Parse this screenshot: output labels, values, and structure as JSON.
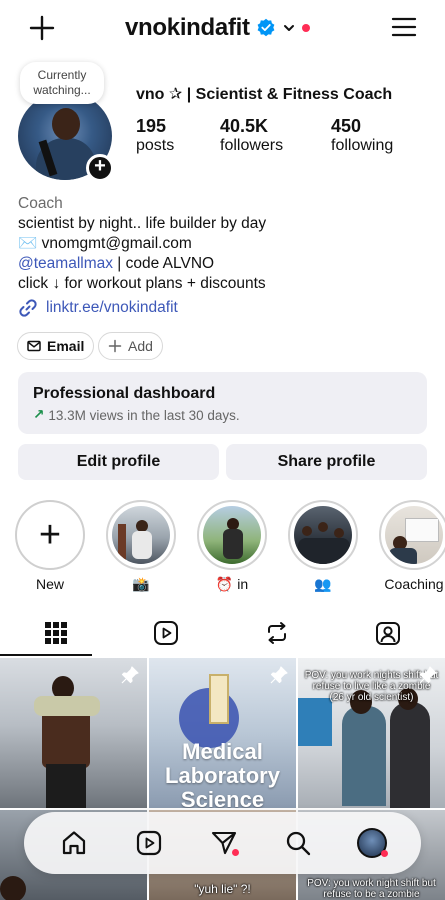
{
  "header": {
    "username": "vnokindafit",
    "icons": [
      "plus-icon",
      "verified-badge-icon",
      "chevron-down-icon",
      "notification-dot",
      "hamburger-menu-icon"
    ]
  },
  "note": {
    "text": "Currently watching..."
  },
  "profile": {
    "full_name": "vno ✰ | Scientist & Fitness Coach",
    "stats": [
      {
        "value": "195",
        "label": "posts"
      },
      {
        "value": "40.5K",
        "label": "followers"
      },
      {
        "value": "450",
        "label": "following"
      }
    ],
    "category": "Coach",
    "bio_line1": "scientist by night.. life builder by day",
    "bio_email_icon": "✉️",
    "bio_email": "vnomgmt@gmail.com",
    "bio_mention": "@teamallmax",
    "bio_code": " | code ALVNO",
    "bio_line4": "click ↓ for workout plans + discounts",
    "link": "linktr.ee/vnokindafit"
  },
  "chips": {
    "email": "Email",
    "add": "Add"
  },
  "dashboard": {
    "title": "Professional dashboard",
    "subtitle": "13.3M views in the last 30 days.",
    "arrow": "↗"
  },
  "buttons": {
    "edit": "Edit profile",
    "share": "Share profile"
  },
  "highlights": [
    {
      "label": "New"
    },
    {
      "label": "📸"
    },
    {
      "label": "⏰ in"
    },
    {
      "label": "👥"
    },
    {
      "label": "Coaching"
    }
  ],
  "tabs": [
    "grid-icon",
    "reels-icon",
    "reposts-icon",
    "tagged-icon"
  ],
  "grid": {
    "tile2_text": "Medical Laboratory Science",
    "tile3_caption": "POV: you work nights shift but refuse to live like a zombie (26 yr old scientist)",
    "tile5_caption": "\"yuh lie\" ?!",
    "tile6_caption": "POV: you work night shift but refuse to be a zombie"
  },
  "colors": {
    "link": "#3d58b8",
    "verified": "#0095f6",
    "notification": "#ff2d55",
    "panel": "#efeff4",
    "growth": "#1a8f4a"
  }
}
